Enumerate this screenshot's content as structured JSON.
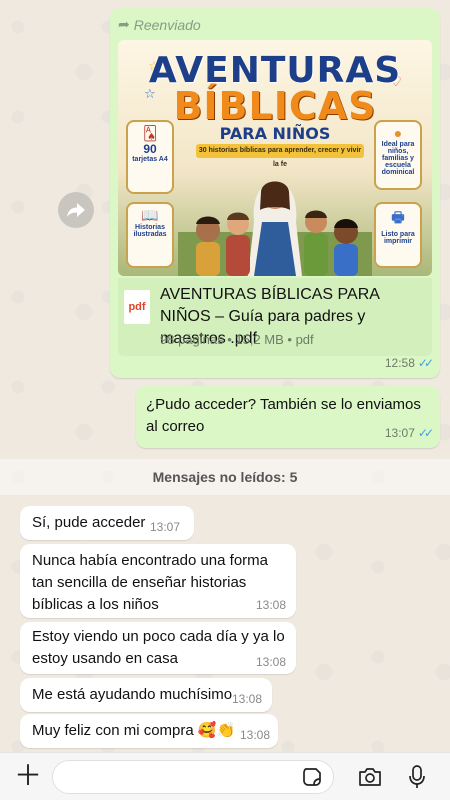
{
  "forward_label": "Reenviado",
  "cover": {
    "title_line1": "AVENTURAS",
    "title_line2": "BÍBLICAS",
    "title_line3": "PARA NIÑOS",
    "ribbon": "30 historias bíblicas para aprender, crecer y vivir la fe",
    "badge_tl_num": "90",
    "badge_tl_label": "tarjetas A4",
    "badge_tr_label": "Ideal para niños, familias y escuela dominical",
    "badge_bl_label": "Historias ilustradas",
    "badge_br_label": "Listo para imprimir"
  },
  "pdf": {
    "icon_label": "pdf",
    "name": "AVENTURAS BÍBLICAS PARA NIÑOS – Guía para padres y maestros .pdf",
    "meta": "98 páginas • 15,2 MB • pdf",
    "time": "12:58"
  },
  "out_message": {
    "text": "¿Pudo acceder? También se lo enviamos al correo",
    "time": "13:07"
  },
  "unread_label": "Mensajes no leídos: 5",
  "incoming": [
    {
      "text": "Sí, pude acceder",
      "time": "13:07"
    },
    {
      "text": "Nunca había encontrado una forma tan sencilla de enseñar historias bíblicas a los niños",
      "time": "13:08"
    },
    {
      "text": "Estoy viendo un poco cada día y ya lo estoy usando en casa",
      "time": "13:08"
    },
    {
      "text": "Me está ayudando muchísimo",
      "time": "13:08"
    },
    {
      "text": "Muy feliz con mi compra 🥰👏",
      "time": "13:08"
    }
  ],
  "composer": {
    "placeholder": ""
  },
  "colors": {
    "outgoing": "#dcf7c6",
    "incoming": "#ffffff",
    "read_ticks": "#3aa0e8",
    "background": "#efe9e0"
  },
  "icons": {
    "forward": "forward-arrow-icon",
    "plus": "plus-icon",
    "sticker": "sticker-icon",
    "camera": "camera-icon",
    "mic": "microphone-icon"
  }
}
